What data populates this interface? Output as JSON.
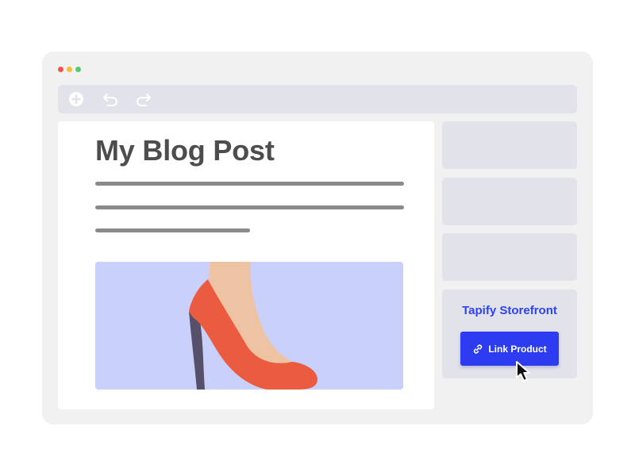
{
  "window": {
    "controls": [
      {
        "name": "close",
        "color": "#f0574a"
      },
      {
        "name": "minimize",
        "color": "#f5bd3d"
      },
      {
        "name": "maximize",
        "color": "#4fcf6a"
      }
    ]
  },
  "toolbar": {
    "buttons": [
      {
        "name": "add",
        "icon": "plus-circle-icon"
      },
      {
        "name": "undo",
        "icon": "undo-icon"
      },
      {
        "name": "redo",
        "icon": "redo-icon"
      }
    ]
  },
  "editor": {
    "title": "My Blog Post",
    "image": {
      "subject": "red-high-heel-shoe",
      "background": "#c9d1fa"
    }
  },
  "sidebar": {
    "storefront": {
      "title": "Tapify Storefront",
      "button_label": "Link Product",
      "button_icon": "link-icon",
      "accent": "#2d3cf0"
    }
  },
  "cursor": {
    "icon": "arrow-pointer-icon"
  }
}
